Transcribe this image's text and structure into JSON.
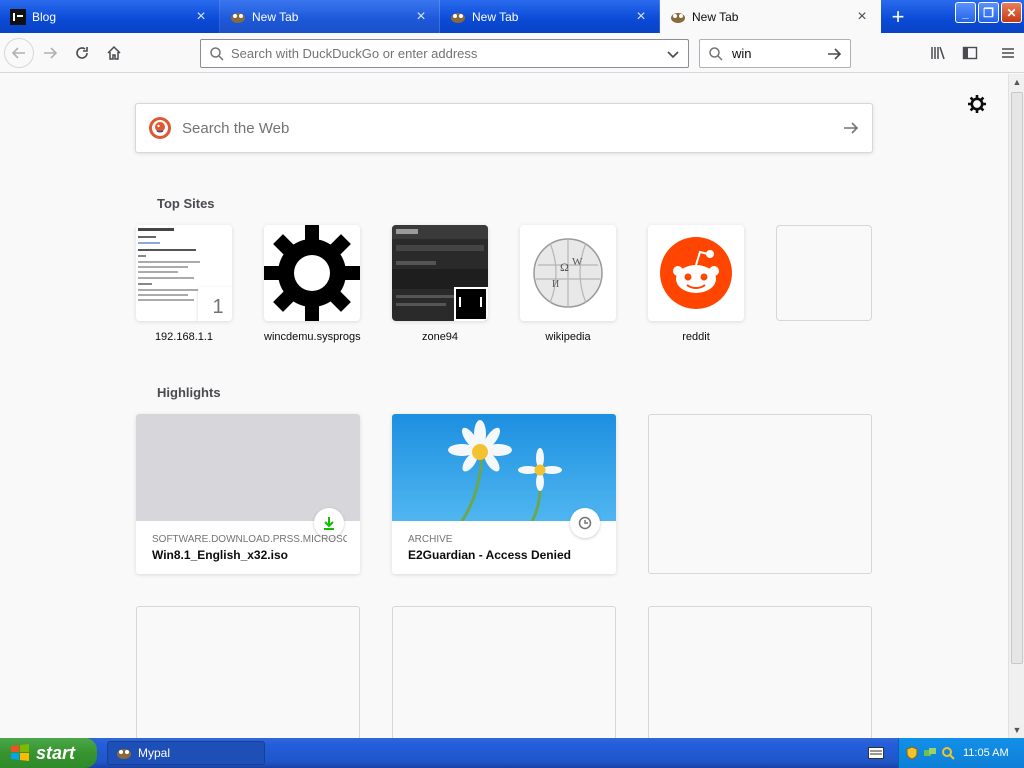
{
  "browser": {
    "tabs": [
      {
        "label": "Blog",
        "icon": "blog-favicon",
        "state": "inactive"
      },
      {
        "label": "New Tab",
        "icon": "mypal-favicon",
        "state": "hover"
      },
      {
        "label": "New Tab",
        "icon": "mypal-favicon",
        "state": "inactive"
      },
      {
        "label": "New Tab",
        "icon": "mypal-favicon",
        "state": "active"
      }
    ],
    "new_tab_symbol": "+",
    "window_controls": {
      "minimize": "_",
      "maximize": "❐",
      "close": "✕"
    }
  },
  "navbar": {
    "url_placeholder": "Search with DuckDuckGo or enter address",
    "search_value": "win"
  },
  "newtab": {
    "search_placeholder": "Search the Web",
    "top_sites_title": "Top Sites",
    "top_sites": [
      {
        "label": "192.168.1.1",
        "pin": "1"
      },
      {
        "label": "wincdemu.sysprogs"
      },
      {
        "label": "zone94"
      },
      {
        "label": "wikipedia"
      },
      {
        "label": "reddit"
      },
      {
        "label": ""
      }
    ],
    "highlights_title": "Highlights",
    "highlights": [
      {
        "context": "SOFTWARE.DOWNLOAD.PRSS.MICROSOF...",
        "title": "Win8.1_English_x32.iso",
        "badge": "download-icon"
      },
      {
        "context": "ARCHIVE",
        "title": "E2Guardian - Access Denied",
        "badge": "clock-icon"
      }
    ]
  },
  "taskbar": {
    "start_label": "start",
    "task_label": "Mypal",
    "clock": "11:05 AM"
  },
  "colors": {
    "tabbar": "#0a4ad6",
    "taskbar": "#245edb",
    "start": "#37942f",
    "reddit": "#ff4500",
    "download_green": "#12bc00"
  }
}
